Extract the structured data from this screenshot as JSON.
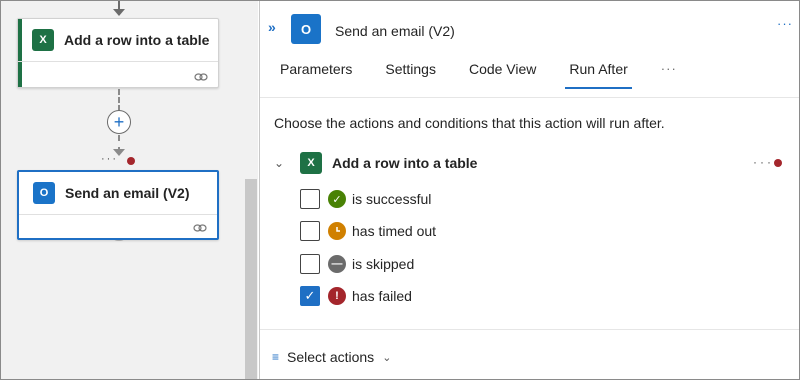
{
  "canvas": {
    "cards": [
      {
        "title": "Add a row into a table",
        "icon": "excel-icon"
      },
      {
        "title": "Send an email (V2)",
        "icon": "outlook-icon"
      }
    ],
    "add_button_label": "+"
  },
  "panel": {
    "title": "Send an email (V2)",
    "icon": "outlook-icon",
    "collapse_glyph": "»",
    "more_glyph": "···",
    "tabs": [
      {
        "label": "Parameters"
      },
      {
        "label": "Settings"
      },
      {
        "label": "Code View"
      },
      {
        "label": "Run After"
      }
    ],
    "tabs_more": "···",
    "intro": "Choose the actions and conditions that this action will run after.",
    "group": {
      "title": "Add a row into a table",
      "options": [
        {
          "label": "is successful",
          "checked": false,
          "status": "success"
        },
        {
          "label": "has timed out",
          "checked": false,
          "status": "timed-out"
        },
        {
          "label": "is skipped",
          "checked": false,
          "status": "skipped"
        },
        {
          "label": "has failed",
          "checked": true,
          "status": "failed"
        }
      ]
    },
    "select_actions": "Select actions"
  },
  "colors": {
    "accent": "#1f6fc4",
    "excel": "#1e7145",
    "outlook": "#1a73c8",
    "success": "#498205",
    "timed_out": "#d08000",
    "skipped": "#6b6b6b",
    "failed": "#a4262c"
  }
}
